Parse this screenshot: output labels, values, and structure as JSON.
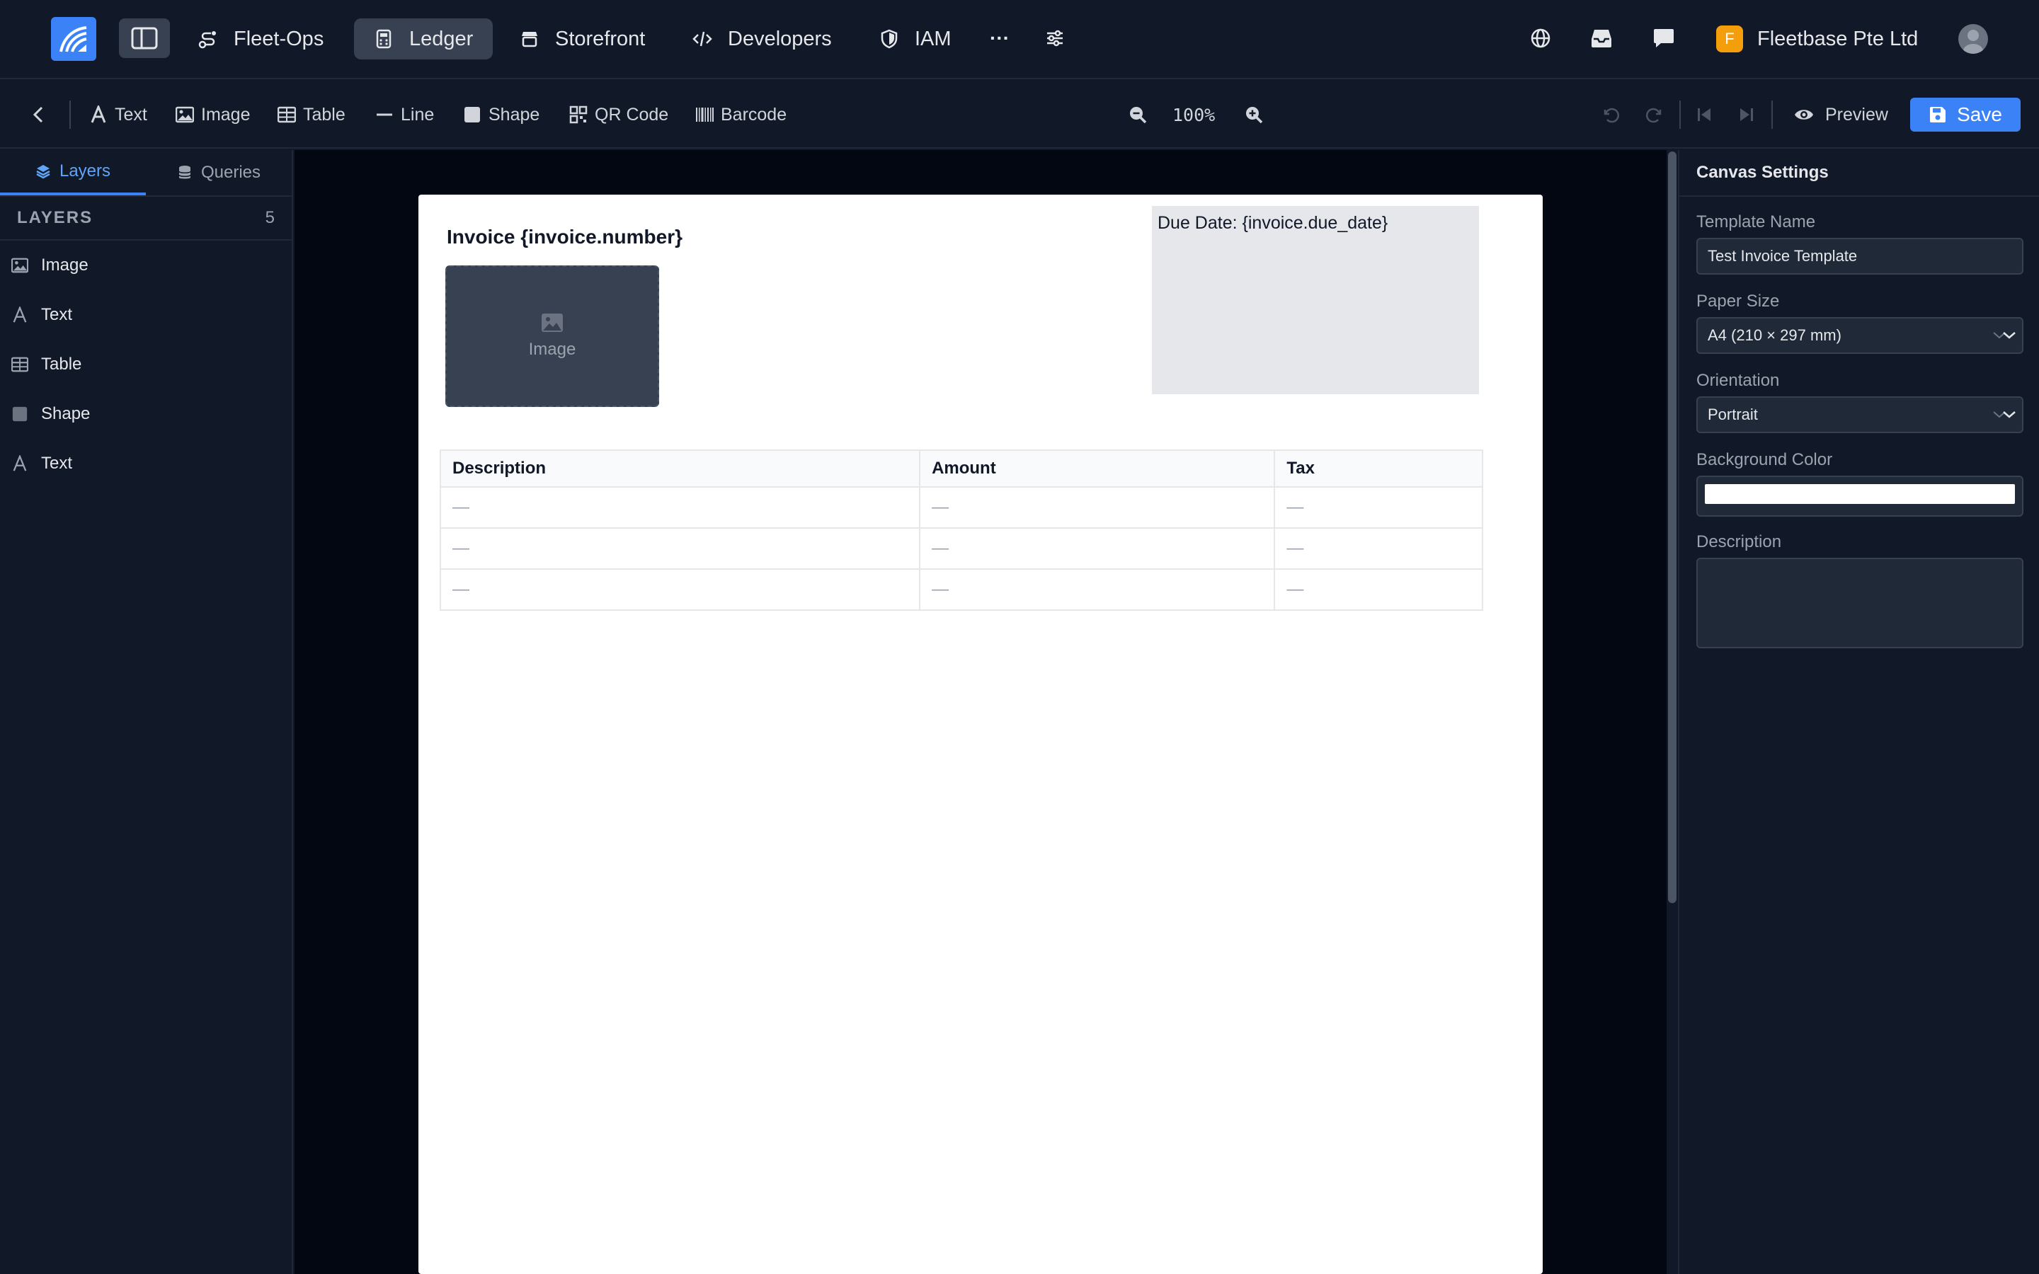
{
  "nav": {
    "items": [
      {
        "label": "Fleet-Ops",
        "icon": "route-icon"
      },
      {
        "label": "Ledger",
        "icon": "calculator-icon",
        "active": true
      },
      {
        "label": "Storefront",
        "icon": "store-icon"
      },
      {
        "label": "Developers",
        "icon": "code-icon"
      },
      {
        "label": "IAM",
        "icon": "shield-icon"
      }
    ],
    "more_label": "···",
    "org_initial": "F",
    "org_name": "Fleetbase Pte Ltd",
    "accent": "#3b82f6",
    "badge_color": "#f59e0b"
  },
  "toolbar": {
    "tools": [
      {
        "label": "Text",
        "icon": "text-icon"
      },
      {
        "label": "Image",
        "icon": "image-icon"
      },
      {
        "label": "Table",
        "icon": "table-icon"
      },
      {
        "label": "Line",
        "icon": "line-icon"
      },
      {
        "label": "Shape",
        "icon": "shape-icon"
      },
      {
        "label": "QR Code",
        "icon": "qrcode-icon"
      },
      {
        "label": "Barcode",
        "icon": "barcode-icon"
      }
    ],
    "zoom": "100%",
    "preview_label": "Preview",
    "save_label": "Save"
  },
  "left_panel": {
    "tabs": [
      {
        "label": "Layers",
        "active": true
      },
      {
        "label": "Queries",
        "active": false
      }
    ],
    "layers_heading": "LAYERS",
    "layers_count": "5",
    "layers": [
      {
        "label": "Image",
        "icon": "image-icon"
      },
      {
        "label": "Text",
        "icon": "text-icon"
      },
      {
        "label": "Table",
        "icon": "table-icon"
      },
      {
        "label": "Shape",
        "icon": "shape-icon"
      },
      {
        "label": "Text",
        "icon": "text-icon"
      }
    ]
  },
  "canvas": {
    "title": "Invoice {invoice.number}",
    "image_placeholder": "Image",
    "due_date_text": "Due Date: {invoice.due_date}",
    "table": {
      "headers": [
        "Description",
        "Amount",
        "Tax"
      ],
      "rows": [
        [
          "—",
          "—",
          "—"
        ],
        [
          "—",
          "—",
          "—"
        ],
        [
          "—",
          "—",
          "—"
        ]
      ]
    }
  },
  "right_panel": {
    "title": "Canvas Settings",
    "template_name_label": "Template Name",
    "template_name_value": "Test Invoice Template",
    "paper_size_label": "Paper Size",
    "paper_size_value": "A4 (210 × 297 mm)",
    "orientation_label": "Orientation",
    "orientation_value": "Portrait",
    "background_color_label": "Background Color",
    "background_color_value": "#ffffff",
    "description_label": "Description",
    "description_value": ""
  }
}
